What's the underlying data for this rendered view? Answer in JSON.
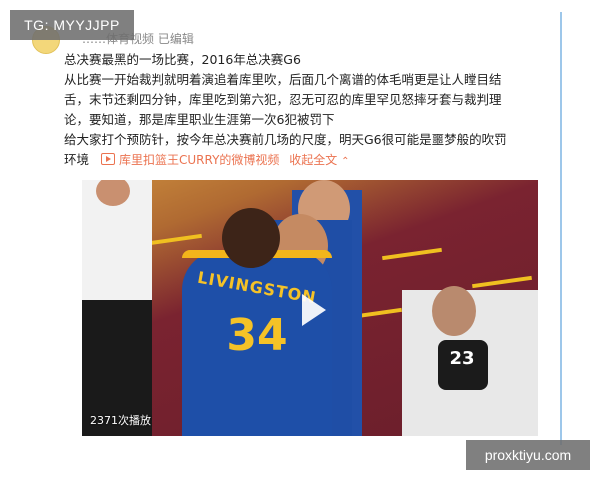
{
  "header": {
    "line_fragment": "……体育视频 已编辑"
  },
  "post": {
    "lines": [
      "总决赛最黑的一场比赛，2016年总决赛G6",
      "从比赛一开始裁判就明着演追着库里吹，后面几个离谱的体毛哨更是让人瞠目结",
      "舌，末节还剩四分钟，库里吃到第六犯，忍无可忍的库里罕见怒摔牙套与裁判理",
      "论，要知道，那是库里职业生涯第一次6犯被罚下",
      "给大家打个预防针，按今年总决赛前几场的尺度，明天G6很可能是噩梦般的吹罚",
      "环境"
    ],
    "source_link": "库里扣篮王CURRY的微博视频",
    "expand_link": "收起全文",
    "expand_icon": "chevron-up-icon"
  },
  "video": {
    "jersey_name": "LIVINGSTON",
    "jersey_number": "34",
    "ref_number": "23",
    "view_count": "2371次播放",
    "play_icon": "play-icon"
  },
  "watermarks": {
    "top_left": "TG: MYYJJPP",
    "bottom_right": "proxktiyu.com"
  },
  "colors": {
    "link": "#eb7350",
    "warriors_blue": "#1e4fa8",
    "warriors_gold": "#f5c227",
    "card_border": "#9dc7ea"
  }
}
